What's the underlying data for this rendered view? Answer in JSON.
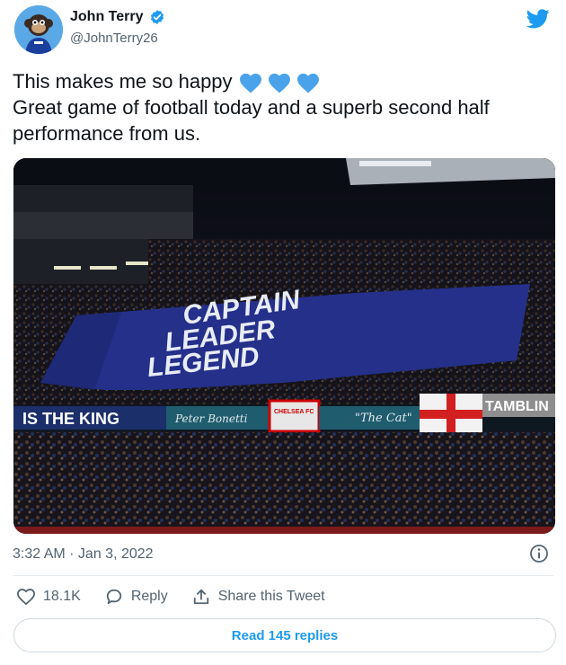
{
  "author": {
    "name": "John Terry",
    "handle": "@JohnTerry26",
    "verified": true
  },
  "tweet": {
    "line1": "This makes me so happy",
    "emoji": "💙💙💙",
    "line2": "Great game of football today and a superb second half performance from us."
  },
  "photo": {
    "banner_lines": [
      "CAPTAIN",
      "LEADER",
      "LEGEND"
    ],
    "stand_banner_left": "IS THE KING",
    "stand_banner_script": "Peter Bonetti",
    "stand_banner_cat": "\"The Cat\"",
    "stand_banner_right": "TAMBLIN",
    "flag_text_1": "CHELSEA FC",
    "flag_text_2": "CHELSEA FC"
  },
  "meta": {
    "timestamp": "3:32 AM · Jan 3, 2022"
  },
  "actions": {
    "likes": "18.1K",
    "reply_label": "Reply",
    "share_label": "Share this Tweet"
  },
  "read_replies_label": "Read 145 replies",
  "colors": {
    "twitter_blue": "#1d9bf0",
    "heart_blue": "#4aa3ea",
    "banner_blue": "#24308a",
    "stand_teal": "#1f5c6e"
  },
  "icons": [
    "verified-badge-icon",
    "twitter-bird-icon",
    "blue-heart-icon",
    "info-icon",
    "heart-icon",
    "reply-icon",
    "share-icon"
  ]
}
